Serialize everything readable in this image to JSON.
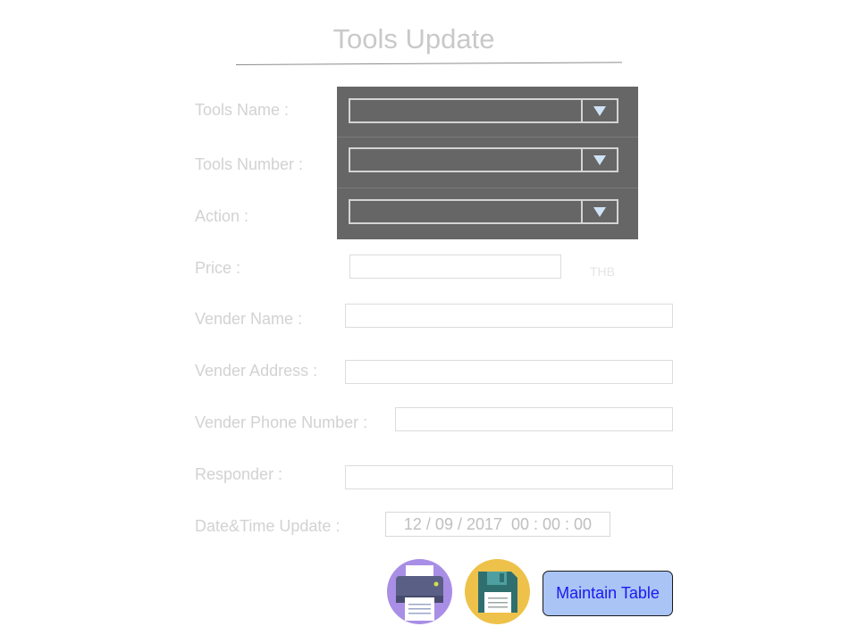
{
  "page": {
    "title": "Tools Update"
  },
  "form": {
    "tools_name_label": "Tools Name :",
    "tools_number_label": "Tools Number :",
    "action_label": "Action :",
    "price_label": "Price :",
    "price_unit": "THB",
    "vender_name_label": "Vender Name :",
    "vender_address_label": "Vender Address :",
    "vender_phone_label": "Vender Phone Number :",
    "responder_label": "Responder :",
    "datetime_label": "Date&Time Update  :",
    "datetime_value": "12 / 09 / 2017  00 : 00 : 00",
    "tools_name_value": "",
    "tools_number_value": "",
    "action_value": "",
    "price_value": "",
    "vender_name_value": "",
    "vender_address_value": "",
    "vender_phone_value": "",
    "responder_value": ""
  },
  "actions": {
    "print_icon": "printer-icon",
    "save_icon": "floppy-disk-icon",
    "maintain_label": "Maintain Table"
  },
  "colors": {
    "dropdown_panel": "#666666",
    "print_circle": "#a98ee6",
    "save_circle": "#eec24a",
    "maintain_button": "#a9c4f5",
    "maintain_text": "#1a1aee"
  }
}
